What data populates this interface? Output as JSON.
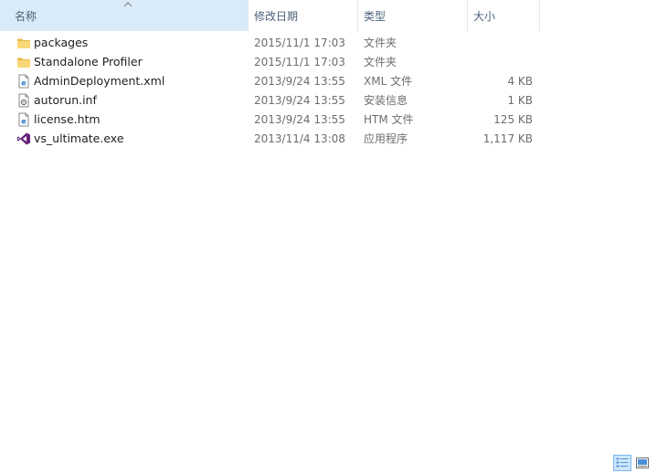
{
  "columns": {
    "name": "名称",
    "date": "修改日期",
    "type": "类型",
    "size": "大小"
  },
  "files": [
    {
      "name": "packages",
      "date": "2015/11/1 17:03",
      "type": "文件夹",
      "size": "",
      "icon": "folder-icon"
    },
    {
      "name": "Standalone Profiler",
      "date": "2015/11/1 17:03",
      "type": "文件夹",
      "size": "",
      "icon": "folder-icon"
    },
    {
      "name": "AdminDeployment.xml",
      "date": "2013/9/24 13:55",
      "type": "XML 文件",
      "size": "4 KB",
      "icon": "xml-file-icon"
    },
    {
      "name": "autorun.inf",
      "date": "2013/9/24 13:55",
      "type": "安装信息",
      "size": "1 KB",
      "icon": "settings-file-icon"
    },
    {
      "name": "license.htm",
      "date": "2013/9/24 13:55",
      "type": "HTM 文件",
      "size": "125 KB",
      "icon": "html-file-icon"
    },
    {
      "name": "vs_ultimate.exe",
      "date": "2013/11/4 13:08",
      "type": "应用程序",
      "size": "1,117 KB",
      "icon": "visual-studio-icon"
    }
  ],
  "colors": {
    "header_text": "#4c607a",
    "folder": "#f8d775",
    "vs_purple": "#68217a",
    "ie_blue": "#1e73c8"
  },
  "view_modes": [
    "details-view-icon",
    "large-icons-view-icon"
  ]
}
